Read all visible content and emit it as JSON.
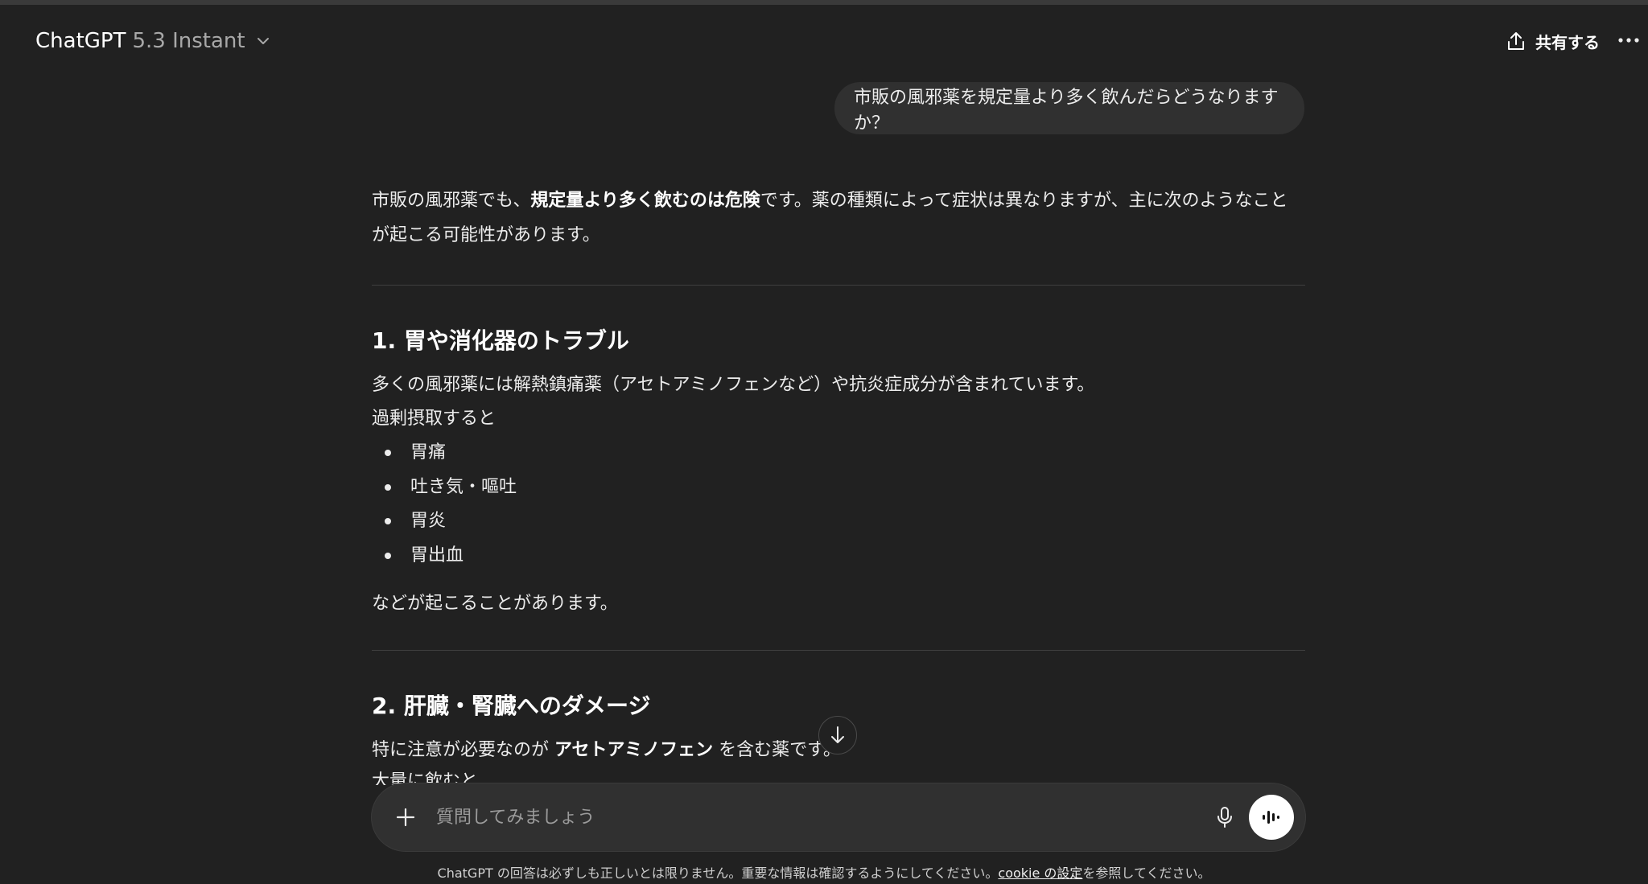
{
  "header": {
    "model_name": "ChatGPT",
    "model_version": "5.3 Instant",
    "share_label": "共有する"
  },
  "conversation": {
    "user_message": "市販の風邪薬を規定量より多く飲んだらどうなりますか？",
    "intro": {
      "part1": "市販の風邪薬でも、",
      "bold": "規定量より多く飲むのは危険",
      "part2": "です。薬の種類によって症状は異なりますが、主に次のようなことが起こる可能性があります。"
    },
    "section1": {
      "heading": "1. 胃や消化器のトラブル",
      "line1": "多くの風邪薬には解熱鎮痛薬（アセトアミノフェンなど）や抗炎症成分が含まれています。",
      "line2": "過剰摂取すると",
      "bullets": [
        "胃痛",
        "吐き気・嘔吐",
        "胃炎",
        "胃出血"
      ],
      "closing": "などが起こることがあります。"
    },
    "section2": {
      "heading": "2. 肝臓・腎臓へのダメージ",
      "line1_part1": "特に注意が必要なのが ",
      "line1_bold": "アセトアミノフェン",
      "line1_part2": " を含む薬です。",
      "line2_cut": "大量に飲むと"
    }
  },
  "composer": {
    "placeholder": "質問してみましょう"
  },
  "footer": {
    "text_before": "ChatGPT の回答は必ずしも正しいとは限りません。重要な情報は確認するようにしてください。",
    "link": "cookie の設定",
    "text_after": "を参照してください。"
  },
  "icons": {
    "model_chevron": "chevron-down-icon",
    "share": "share-icon",
    "more": "more-horizontal-icon",
    "scroll": "arrow-down-icon",
    "attach": "plus-icon",
    "mic": "microphone-icon",
    "voice": "voice-waveform-icon"
  },
  "colors": {
    "background": "#212121",
    "bubble": "#303030",
    "text": "#ececec"
  }
}
